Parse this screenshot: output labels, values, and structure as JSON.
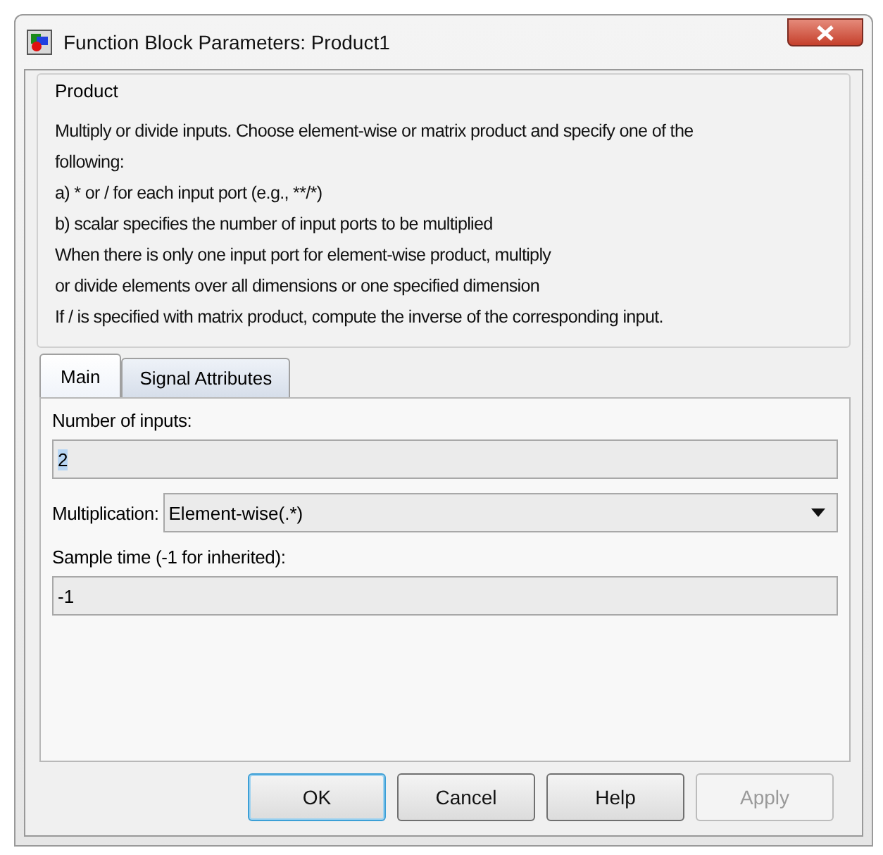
{
  "window": {
    "title": "Function Block Parameters: Product1"
  },
  "description": {
    "title": "Product",
    "lines": [
      "Multiply or divide inputs.  Choose element-wise or matrix product and specify one of the",
      "following:",
      "a) * or / for each input port (e.g., **/*)",
      "b) scalar specifies the number of input ports to be multiplied",
      "When there is only one input port for element-wise product, multiply",
      "or divide elements over all dimensions or one specified dimension",
      "If / is specified with matrix product, compute the inverse of the corresponding input."
    ]
  },
  "tabs": [
    {
      "label": "Main",
      "selected": true
    },
    {
      "label": "Signal Attributes",
      "selected": false
    }
  ],
  "fields": [
    {
      "kind": "text",
      "label": "Number of inputs:",
      "value": "2",
      "text_selected": true
    },
    {
      "kind": "dropdown",
      "label": "Multiplication:",
      "value": "Element-wise(.*)",
      "text_selected": false
    },
    {
      "kind": "text",
      "label": "Sample time (-1 for inherited):",
      "value": "-1",
      "text_selected": false
    }
  ],
  "buttons": [
    {
      "label": "OK",
      "default": true,
      "disabled": false
    },
    {
      "label": "Cancel",
      "default": false,
      "disabled": false
    },
    {
      "label": "Help",
      "default": false,
      "disabled": false
    },
    {
      "label": "Apply",
      "default": false,
      "disabled": true
    }
  ]
}
